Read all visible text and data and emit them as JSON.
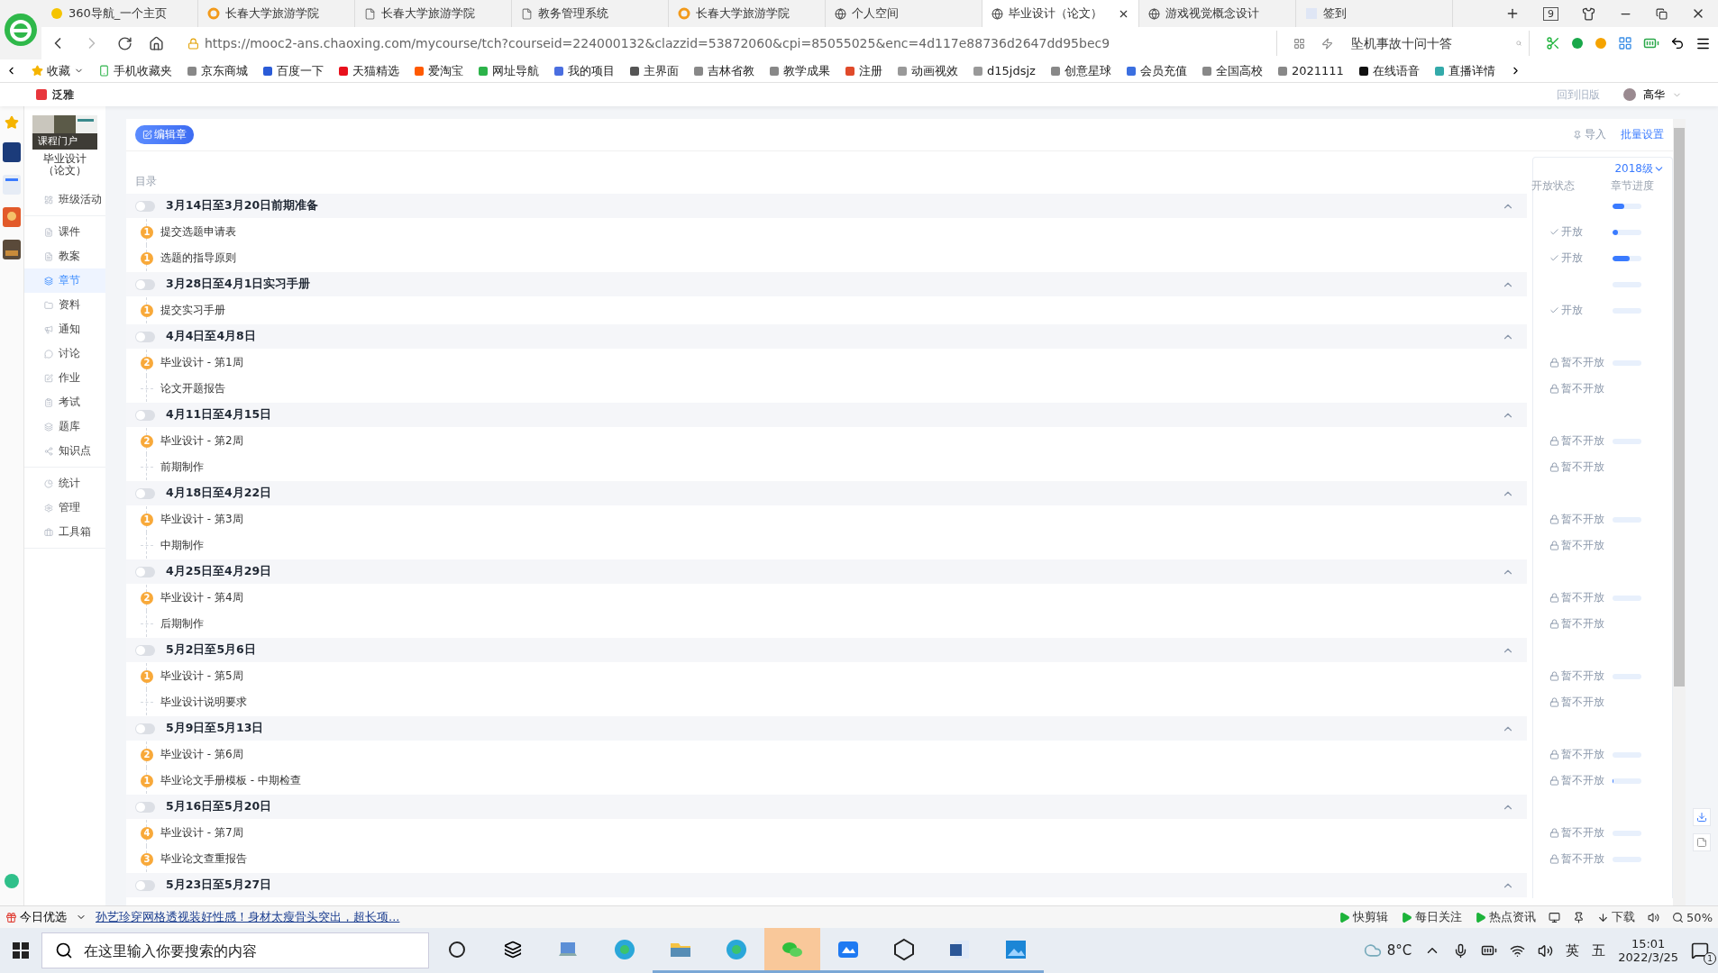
{
  "browser": {
    "tabs": [
      {
        "title": "360导航_一个主页",
        "selected": false
      },
      {
        "title": "长春大学旅游学院",
        "selected": false
      },
      {
        "title": "长春大学旅游学院",
        "selected": false
      },
      {
        "title": "教务管理系统",
        "selected": false
      },
      {
        "title": "长春大学旅游学院",
        "selected": false
      },
      {
        "title": "个人空间",
        "selected": false
      },
      {
        "title": "毕业设计（论文）",
        "selected": true
      },
      {
        "title": "游戏视觉概念设计",
        "selected": false
      },
      {
        "title": "签到",
        "selected": false
      }
    ],
    "tab_count": "9",
    "url": "https://mooc2-ans.chaoxing.com/mycourse/tch?courseid=224000132&clazzid=53872060&cpi=85055025&enc=4d117e88736d2647dd95bec9",
    "search": {
      "placeholder": "坠机事故十问十答"
    },
    "bookmarks": [
      "收藏",
      "手机收藏夹",
      "京东商城",
      "百度一下",
      "天猫精选",
      "爱淘宝",
      "网址导航",
      "我的项目",
      "主界面",
      "吉林省教",
      "教学成果",
      "注册",
      "动画视效",
      "d15jdsjz",
      "创意星球",
      "会员充值",
      "全国高校",
      "2021111",
      "在线语音",
      "直播详情"
    ]
  },
  "header": {
    "brand": "泛雅",
    "back_link": "回到旧版",
    "user": "高华"
  },
  "sidebar": {
    "cover_label": "课程门户",
    "course_title": "毕业设计（论文）",
    "groups": [
      {
        "items": [
          {
            "label": "班级活动",
            "selected": false
          }
        ]
      },
      {
        "items": [
          {
            "label": "课件",
            "selected": false
          },
          {
            "label": "教案",
            "selected": false
          },
          {
            "label": "章节",
            "selected": true
          },
          {
            "label": "资料",
            "selected": false
          },
          {
            "label": "通知",
            "selected": false
          },
          {
            "label": "讨论",
            "selected": false
          },
          {
            "label": "作业",
            "selected": false
          },
          {
            "label": "考试",
            "selected": false
          },
          {
            "label": "题库",
            "selected": false
          },
          {
            "label": "知识点",
            "selected": false
          }
        ]
      },
      {
        "items": [
          {
            "label": "统计",
            "selected": false
          },
          {
            "label": "管理",
            "selected": false
          },
          {
            "label": "工具箱",
            "selected": false
          }
        ]
      }
    ]
  },
  "toolbar": {
    "edit_button": "编辑章",
    "import": "导入",
    "batch": "批量设置"
  },
  "catalog_label": "目录",
  "status_panel": {
    "grade": "2018级",
    "columns": [
      "开放状态",
      "章节进度"
    ]
  },
  "sections": [
    {
      "title": "3月14日至3月20日前期准备",
      "on": false,
      "expanded": true,
      "level": 0.4,
      "items": [
        {
          "badge": "1",
          "title": "提交选题申请表",
          "locked": false,
          "status": "开放",
          "level": 0.2
        },
        {
          "badge": "1",
          "title": "选题的指导原则",
          "locked": false,
          "status": "开放",
          "level": 0.6
        }
      ]
    },
    {
      "title": "3月28日至4月1日实习手册",
      "on": false,
      "expanded": true,
      "level": 0,
      "items": [
        {
          "badge": "1",
          "title": "提交实习手册",
          "locked": false,
          "status": "开放",
          "level": 0
        }
      ]
    },
    {
      "title": "4月4日至4月8日",
      "on": false,
      "expanded": true,
      "items": [
        {
          "badge": "2",
          "title": "毕业设计 - 第1周",
          "locked": true,
          "status": "暂不开放",
          "level": 0
        },
        {
          "title": "论文开题报告",
          "locked": true,
          "status": "暂不开放"
        }
      ]
    },
    {
      "title": "4月11日至4月15日",
      "on": false,
      "expanded": true,
      "items": [
        {
          "badge": "2",
          "title": "毕业设计 - 第2周",
          "locked": true,
          "status": "暂不开放",
          "level": 0
        },
        {
          "title": "前期制作",
          "locked": true,
          "status": "暂不开放"
        }
      ]
    },
    {
      "title": "4月18日至4月22日",
      "on": false,
      "expanded": true,
      "items": [
        {
          "badge": "1",
          "title": "毕业设计 - 第3周",
          "locked": true,
          "status": "暂不开放",
          "level": 0
        },
        {
          "title": "中期制作",
          "locked": true,
          "status": "暂不开放"
        }
      ]
    },
    {
      "title": "4月25日至4月29日",
      "on": false,
      "expanded": true,
      "items": [
        {
          "badge": "2",
          "title": "毕业设计 - 第4周",
          "locked": true,
          "status": "暂不开放",
          "level": 0
        },
        {
          "title": "后期制作",
          "locked": true,
          "status": "暂不开放"
        }
      ]
    },
    {
      "title": "5月2日至5月6日",
      "on": false,
      "expanded": true,
      "items": [
        {
          "badge": "1",
          "title": "毕业设计 - 第5周",
          "locked": true,
          "status": "暂不开放",
          "level": 0
        },
        {
          "title": "毕业设计说明要求",
          "locked": true,
          "status": "暂不开放"
        }
      ]
    },
    {
      "title": "5月9日至5月13日",
      "on": false,
      "expanded": true,
      "items": [
        {
          "badge": "2",
          "title": "毕业设计 - 第6周",
          "locked": true,
          "status": "暂不开放",
          "level": 0
        },
        {
          "badge": "1",
          "title": "毕业论文手册模板 - 中期检查",
          "locked": true,
          "status": "暂不开放",
          "level": 0.03
        }
      ]
    },
    {
      "title": "5月16日至5月20日",
      "on": false,
      "expanded": true,
      "items": [
        {
          "badge": "4",
          "title": "毕业设计 - 第7周",
          "locked": true,
          "status": "暂不开放",
          "level": 0
        },
        {
          "badge": "3",
          "title": "毕业论文查重报告",
          "locked": true,
          "status": "暂不开放",
          "level": 0
        }
      ]
    },
    {
      "title": "5月23日至5月27日",
      "on": false,
      "expanded": true
    }
  ],
  "status_bar": {
    "label": "今日优选",
    "news": "孙艺珍穿网格透视装好性感！身材太瘦骨头突出，超长项...",
    "items": [
      "快剪辑",
      "每日关注",
      "热点资讯"
    ],
    "download": "下载",
    "zoom": "50%"
  },
  "taskbar": {
    "search": {
      "placeholder": "在这里输入你要搜索的内容"
    },
    "apps": [
      {
        "running": false
      },
      {
        "running": false
      },
      {
        "running": true
      },
      {
        "running": true
      },
      {
        "running": true
      },
      {
        "running": true
      },
      {
        "running": true
      },
      {
        "running": true
      },
      {
        "running": true
      }
    ],
    "weather": "8°C",
    "ime": "英",
    "ime_mode": "五",
    "time": "15:01",
    "date": "2022/3/25",
    "notifications": "1"
  }
}
